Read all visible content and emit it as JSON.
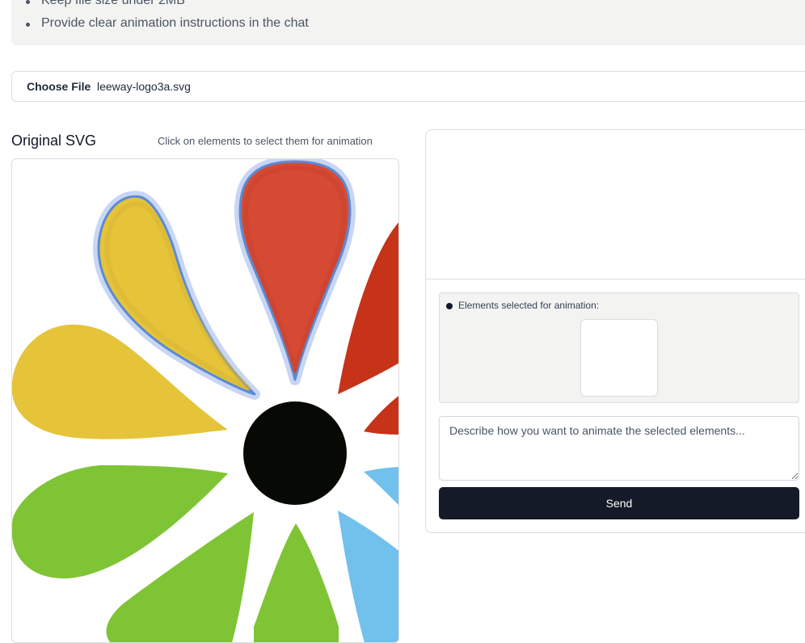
{
  "notice": {
    "items": [
      "Keep file size under 2MB",
      "Provide clear animation instructions in the chat"
    ]
  },
  "file_input": {
    "button_label": "Choose File",
    "file_name": "leeway-logo3a.svg"
  },
  "original_svg": {
    "title": "Original SVG",
    "hint": "Click on elements to select them for animation"
  },
  "animation_panel": {
    "selected_label": "Elements selected for animation:",
    "prompt_placeholder": "Describe how you want to animate the selected elements...",
    "prompt_value": "",
    "send_label": "Send"
  },
  "colors": {
    "yellow_petal": "#e5c43a",
    "red_petal": "#d64a34",
    "dark_red_petal": "#c63318",
    "green_petal": "#7fc435",
    "blue_petal": "#72c0ec",
    "center": "#070a04",
    "selection_outline": "#5b8bd4",
    "selection_halo": "#c8d6f4",
    "send_button": "#141a27"
  }
}
